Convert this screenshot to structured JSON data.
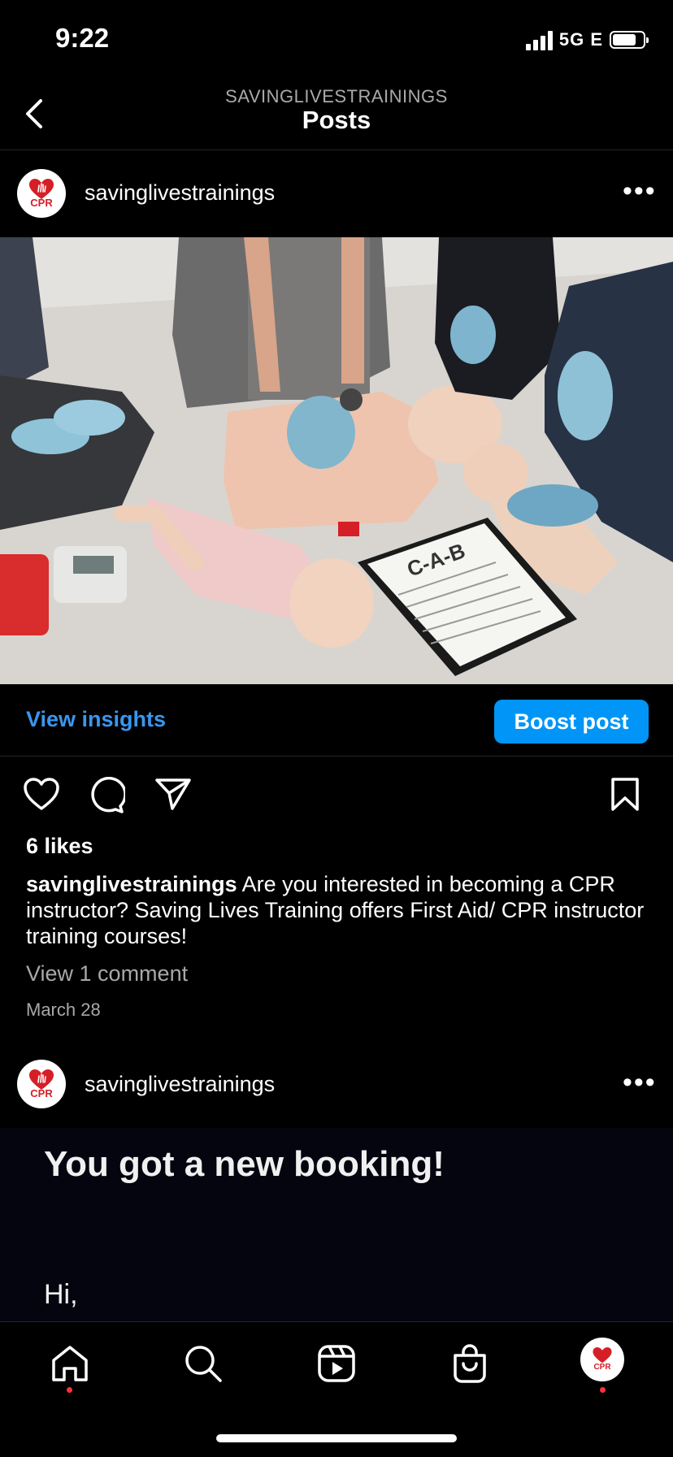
{
  "status": {
    "time": "9:22",
    "network": "5G E"
  },
  "header": {
    "account": "SAVINGLIVESTRAININGS",
    "title": "Posts"
  },
  "posts": [
    {
      "username": "savinglivestrainings",
      "avatar_text": "CPR",
      "insights_label": "View insights",
      "boost_label": "Boost post",
      "likes": "6 likes",
      "caption_user": "savinglivestrainings",
      "caption_text": " Are you interested in becoming a CPR instructor? Saving Lives Training offers First Aid/ CPR instructor training courses!",
      "comments_label": "View 1 comment",
      "date": "March 28",
      "photo_clipboard_text": "C-A-B"
    },
    {
      "username": "savinglivestrainings",
      "avatar_text": "CPR",
      "image_title": "You got a new booking!",
      "image_greeting": "Hi,"
    }
  ],
  "tabbar": {
    "profile_avatar_text": "CPR"
  },
  "colors": {
    "accent": "#0095f6",
    "link": "#3897f0",
    "notification": "#ff3040",
    "brand_red": "#d41f26"
  }
}
